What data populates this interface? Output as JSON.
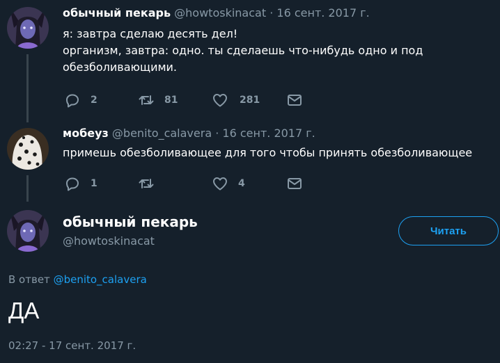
{
  "tweets": [
    {
      "name": "обычный пекарь",
      "handle": "@howtoskinacat",
      "separator": "·",
      "date": "16 сент. 2017 г.",
      "lines": [
        "я: завтра сделаю десять дел!",
        "организм, завтра: одно. ты сделаешь что-нибудь одно и под",
        "обезболивающими."
      ],
      "replies": "2",
      "retweets": "81",
      "likes": "281"
    },
    {
      "name": "мобеуз",
      "handle": "@benito_calavera",
      "separator": "·",
      "date": "16 сент. 2017 г.",
      "lines": [
        "примешь обезболивающее для того чтобы принять обезболивающее"
      ],
      "replies": "1",
      "retweets": "",
      "likes": "4"
    }
  ],
  "main": {
    "name": "обычный пекарь",
    "handle": "@howtoskinacat",
    "follow_label": "Читать",
    "reply_prefix": "В ответ",
    "reply_mention": "@benito_calavera",
    "text": "ДА",
    "timestamp": "02:27 - 17 сент. 2017 г."
  },
  "icons": {
    "reply": "reply-icon",
    "retweet": "retweet-icon",
    "like": "heart-icon",
    "dm": "envelope-icon"
  },
  "colors": {
    "background": "#15202b",
    "accent": "#1da1f2",
    "secondary_text": "#8899a6",
    "divider": "#38444d"
  }
}
